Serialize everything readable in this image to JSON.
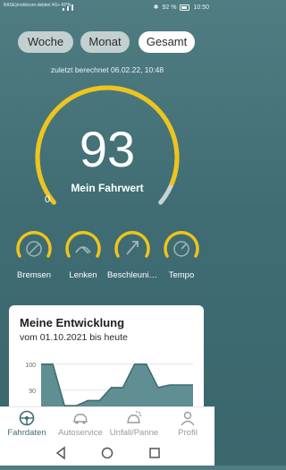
{
  "status_bar": {
    "carrier": "BASE|mobilcom-debitel 4G+ KPN",
    "battery": "92 %",
    "time": "10:50"
  },
  "period_tabs": [
    {
      "label": "Woche",
      "selected": false
    },
    {
      "label": "Monat",
      "selected": false
    },
    {
      "label": "Gesamt",
      "selected": true
    }
  ],
  "score": {
    "computed_text": "zuletzt berechnet 06.02.22, 10:48",
    "value": "93",
    "label": "Mein Fahrwert",
    "min_label": "0",
    "fraction": 0.93
  },
  "categories": [
    {
      "label": "Bremsen",
      "icon": "brake-icon"
    },
    {
      "label": "Lenken",
      "icon": "steering-wheel-icon"
    },
    {
      "label": "Beschleunigen",
      "icon": "acceleration-icon"
    },
    {
      "label": "Tempo",
      "icon": "speedometer-icon"
    }
  ],
  "development_card": {
    "title": "Meine Entwicklung",
    "subtitle": "vom 01.10.2021 bis heute",
    "chart_data": {
      "type": "area",
      "ytick_labels": [
        "100",
        "90"
      ],
      "ylim": [
        82,
        102
      ],
      "values": [
        100,
        100,
        84,
        84,
        86,
        86,
        91,
        91,
        100,
        100,
        91,
        92,
        92,
        92
      ]
    }
  },
  "bottom_nav": [
    {
      "label": "Fahrdaten",
      "icon": "steering-wheel-icon",
      "active": true
    },
    {
      "label": "Autoservice",
      "icon": "car-service-icon",
      "active": false
    },
    {
      "label": "Unfall/Panne",
      "icon": "car-crash-icon",
      "active": false
    },
    {
      "label": "Profil",
      "icon": "person-icon",
      "active": false
    }
  ],
  "colors": {
    "accent": "#f0c419",
    "background": "#46767c",
    "nav_active": "#3f6d73",
    "track": "#c9d3d3"
  }
}
